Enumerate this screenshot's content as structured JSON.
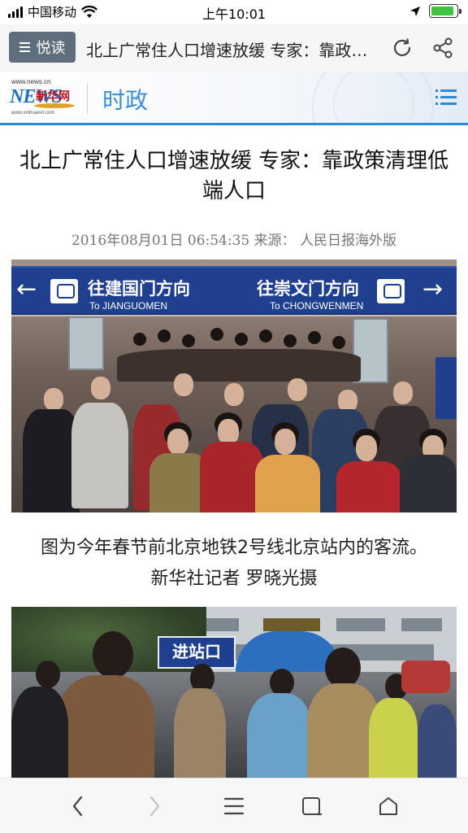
{
  "status_bar": {
    "carrier": "中国移动",
    "time": "上午10:01",
    "battery_level": 0.9,
    "icons": [
      "signal-icon",
      "wifi-icon",
      "location-icon",
      "battery-icon"
    ]
  },
  "app_bar": {
    "reader_label": "悦读",
    "title": "北上广常住人口增速放缓 专家：靠政策清理低端人口",
    "icons": [
      "menu-icon",
      "refresh-icon",
      "share-icon"
    ]
  },
  "channel": {
    "logo": {
      "site": "www.news.cn",
      "brand_cn": "新华网",
      "brand_en": "NEWS",
      "url": "www.xinhuanet.com"
    },
    "name": "时政",
    "icons": [
      "list-icon"
    ]
  },
  "article": {
    "title": "北上广常住人口增速放缓 专家：靠政策清理低端人口",
    "meta": "2016年08月01日 06:54:35 来源： 人民日报海外版",
    "photo1_sign": {
      "left_cn": "往建国门方向",
      "left_en": "To JIANGUOMEN",
      "right_cn": "往崇文门方向",
      "right_en": "To CHONGWENMEN"
    },
    "caption_line1": "图为今年春节前北京地铁2号线北京站内的客流。",
    "caption_line2": "新华社记者 罗晓光摄",
    "photo2_sign": "进站口"
  },
  "bottom_bar": {
    "icons": [
      "back-icon",
      "forward-icon",
      "menu-icon",
      "tabs-icon",
      "home-icon"
    ]
  },
  "colors": {
    "accent": "#2d8bd6",
    "reader_button": "#5f6e7c",
    "battery": "#3fc23f",
    "sign_blue": "#1f3f8f"
  }
}
